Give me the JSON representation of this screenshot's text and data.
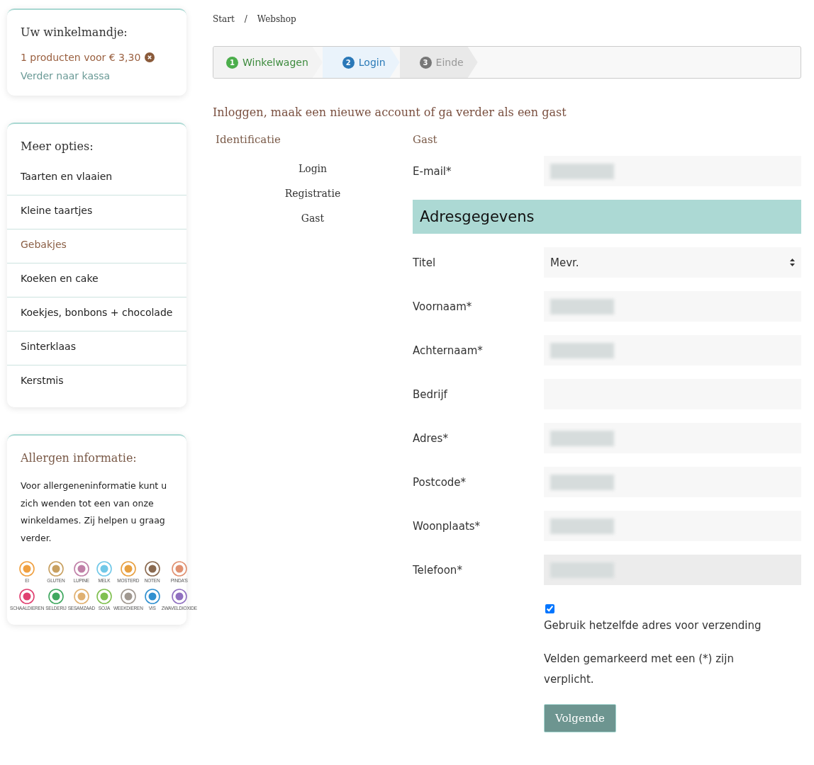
{
  "cart": {
    "title": "Uw winkelmandje:",
    "summary": "1 producten voor € 3,30",
    "checkout_link": "Verder naar kassa"
  },
  "options": {
    "title": "Meer opties:",
    "items": [
      {
        "label": "Taarten en vlaaien",
        "selected": false
      },
      {
        "label": "Kleine taartjes",
        "selected": false
      },
      {
        "label": "Gebakjes",
        "selected": true
      },
      {
        "label": "Koeken en cake",
        "selected": false
      },
      {
        "label": "Koekjes, bonbons + chocolade",
        "selected": false
      },
      {
        "label": "Sinterklaas",
        "selected": false
      },
      {
        "label": "Kerstmis",
        "selected": false
      }
    ]
  },
  "allergens": {
    "title": "Allergen informatie:",
    "text": "Voor allergeneninformatie kunt u zich wenden tot een van onze winkeldames. Zij helpen u graag verder.",
    "icons": [
      {
        "label": "EI",
        "color": "#f0a040"
      },
      {
        "label": "GLUTEN",
        "color": "#c8a060"
      },
      {
        "label": "LUPINE",
        "color": "#c080a8"
      },
      {
        "label": "MELK",
        "color": "#70c8e8"
      },
      {
        "label": "MOSTERD",
        "color": "#e8a040"
      },
      {
        "label": "NOTEN",
        "color": "#8a6a50"
      },
      {
        "label": "PINDA'S",
        "color": "#e09070"
      },
      {
        "label": "SCHAALDIEREN",
        "color": "#e04070"
      },
      {
        "label": "SELDERIJ",
        "color": "#40a860"
      },
      {
        "label": "SESAMZAAD",
        "color": "#e0b070"
      },
      {
        "label": "SOJA",
        "color": "#80c050"
      },
      {
        "label": "WEEKDIEREN",
        "color": "#a09890"
      },
      {
        "label": "VIS",
        "color": "#3090d0"
      },
      {
        "label": "ZWAVELDIOXIDE",
        "color": "#9070c0"
      }
    ]
  },
  "breadcrumb": {
    "items": [
      "Start",
      "Webshop"
    ],
    "separator": "/"
  },
  "steps": [
    {
      "number": "1",
      "label": "Winkelwagen",
      "done": true,
      "selected": false
    },
    {
      "number": "2",
      "label": "Login",
      "done": false,
      "selected": true
    },
    {
      "number": "3",
      "label": "Einde",
      "done": false,
      "selected": false
    }
  ],
  "heading": "Inloggen, maak een nieuwe account of ga verder als een gast",
  "identification": {
    "title": "Identificatie",
    "links": [
      {
        "label": "Login"
      },
      {
        "label": "Registratie"
      },
      {
        "label": "Gast"
      }
    ]
  },
  "guest_title": "Gast",
  "email": {
    "label": "E-mail*",
    "blurred": true
  },
  "address_heading": "Adresgegevens",
  "fields": [
    {
      "label": "Titel",
      "kind": "select",
      "value": "Mevr."
    },
    {
      "label": "Voornaam*",
      "kind": "text",
      "blurred": true
    },
    {
      "label": "Achternaam*",
      "kind": "text",
      "blurred": true
    },
    {
      "label": "Bedrijf",
      "kind": "text",
      "blurred": false
    },
    {
      "label": "Adres*",
      "kind": "text",
      "blurred": true
    },
    {
      "label": "Postcode*",
      "kind": "text",
      "blurred": true
    },
    {
      "label": "Woonplaats*",
      "kind": "text",
      "blurred": true
    },
    {
      "label": "Telefoon*",
      "kind": "text",
      "blurred": true,
      "focused": true
    }
  ],
  "same_address": {
    "label": "Gebruik hetzelfde adres voor verzending",
    "checked": true
  },
  "required_note": "Velden gemarkeerd met een (*) zijn verplicht.",
  "next_button": "Volgende"
}
